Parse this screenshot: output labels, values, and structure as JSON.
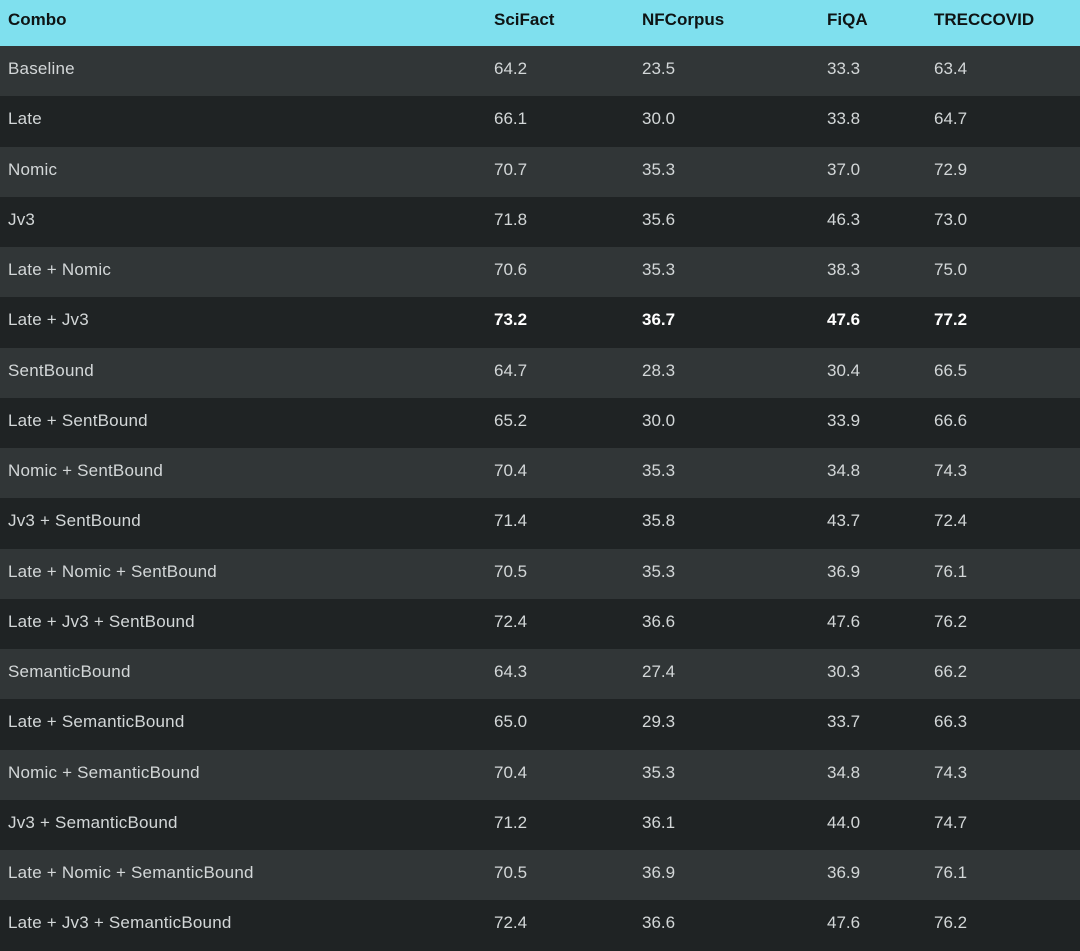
{
  "table": {
    "headers": [
      "Combo",
      "SciFact",
      "NFCorpus",
      "FiQA",
      "TRECCOVID"
    ],
    "rows": [
      {
        "combo": "Baseline",
        "scifact": "64.2",
        "nfcorpus": "23.5",
        "fiqa": "33.3",
        "treccovid": "63.4"
      },
      {
        "combo": "Late",
        "scifact": "66.1",
        "nfcorpus": "30.0",
        "fiqa": "33.8",
        "treccovid": "64.7"
      },
      {
        "combo": "Nomic",
        "scifact": "70.7",
        "nfcorpus": "35.3",
        "fiqa": "37.0",
        "treccovid": "72.9"
      },
      {
        "combo": "Jv3",
        "scifact": "71.8",
        "nfcorpus": "35.6",
        "fiqa": "46.3",
        "treccovid": "73.0"
      },
      {
        "combo": "Late + Nomic",
        "scifact": "70.6",
        "nfcorpus": "35.3",
        "fiqa": "38.3",
        "treccovid": "75.0"
      },
      {
        "combo": "Late + Jv3",
        "scifact": "73.2",
        "nfcorpus": "36.7",
        "fiqa": "47.6",
        "treccovid": "77.2",
        "bold": true
      },
      {
        "combo": "SentBound",
        "scifact": "64.7",
        "nfcorpus": "28.3",
        "fiqa": "30.4",
        "treccovid": "66.5"
      },
      {
        "combo": "Late + SentBound",
        "scifact": "65.2",
        "nfcorpus": "30.0",
        "fiqa": "33.9",
        "treccovid": "66.6"
      },
      {
        "combo": "Nomic + SentBound",
        "scifact": "70.4",
        "nfcorpus": "35.3",
        "fiqa": "34.8",
        "treccovid": "74.3"
      },
      {
        "combo": "Jv3 + SentBound",
        "scifact": "71.4",
        "nfcorpus": "35.8",
        "fiqa": "43.7",
        "treccovid": "72.4"
      },
      {
        "combo": "Late + Nomic + SentBound",
        "scifact": "70.5",
        "nfcorpus": "35.3",
        "fiqa": "36.9",
        "treccovid": "76.1"
      },
      {
        "combo": "Late + Jv3 + SentBound",
        "scifact": "72.4",
        "nfcorpus": "36.6",
        "fiqa": "47.6",
        "treccovid": "76.2"
      },
      {
        "combo": "SemanticBound",
        "scifact": "64.3",
        "nfcorpus": "27.4",
        "fiqa": "30.3",
        "treccovid": "66.2"
      },
      {
        "combo": "Late + SemanticBound",
        "scifact": "65.0",
        "nfcorpus": "29.3",
        "fiqa": "33.7",
        "treccovid": "66.3"
      },
      {
        "combo": "Nomic + SemanticBound",
        "scifact": "70.4",
        "nfcorpus": "35.3",
        "fiqa": "34.8",
        "treccovid": "74.3"
      },
      {
        "combo": "Jv3 + SemanticBound",
        "scifact": "71.2",
        "nfcorpus": "36.1",
        "fiqa": "44.0",
        "treccovid": "74.7"
      },
      {
        "combo": "Late + Nomic + SemanticBound",
        "scifact": "70.5",
        "nfcorpus": "36.9",
        "fiqa": "36.9",
        "treccovid": "76.1"
      },
      {
        "combo": "Late + Jv3 + SemanticBound",
        "scifact": "72.4",
        "nfcorpus": "36.6",
        "fiqa": "47.6",
        "treccovid": "76.2"
      }
    ]
  },
  "colors": {
    "header_bg": "#7fe0ee",
    "row_odd": "#313637",
    "row_even": "#1f2324",
    "text": "#d3d7d8"
  }
}
